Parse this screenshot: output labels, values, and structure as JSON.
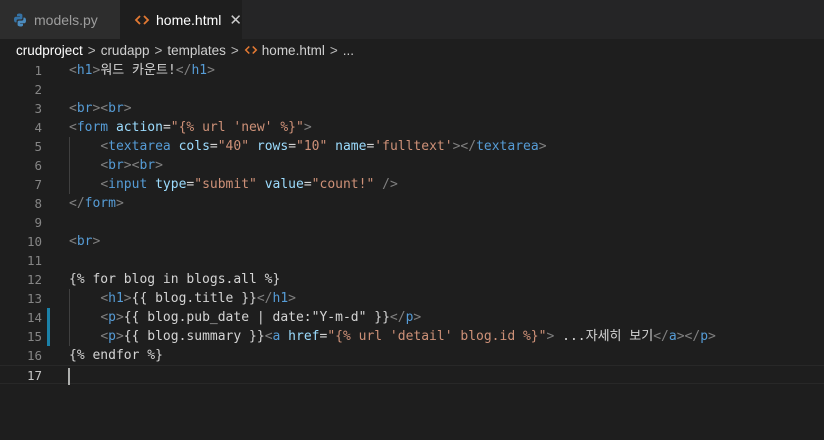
{
  "tabs": [
    {
      "label": "models.py",
      "icon": "python-icon",
      "active": false
    },
    {
      "label": "home.html",
      "icon": "html-icon",
      "active": true,
      "close": "✕"
    }
  ],
  "breadcrumb": {
    "items": [
      "crudproject",
      "crudapp",
      "templates",
      "home.html",
      "..."
    ],
    "separator": ">"
  },
  "colors": {
    "editor_bg": "#1e1e1e",
    "tag": "#569cd6",
    "attribute": "#9cdcfe",
    "string": "#ce9178",
    "text": "#d4d4d4",
    "bracket": "#808080",
    "line_number": "#858585",
    "modified_marker": "#1b81a8"
  },
  "editor": {
    "lines": [
      {
        "n": "1",
        "tokens": [
          [
            "br",
            "<"
          ],
          [
            "tag",
            "h1"
          ],
          [
            "br",
            ">"
          ],
          [
            "txt",
            "워드 카운트!"
          ],
          [
            "br",
            "</"
          ],
          [
            "tag",
            "h1"
          ],
          [
            "br",
            ">"
          ]
        ]
      },
      {
        "n": "2",
        "tokens": []
      },
      {
        "n": "3",
        "tokens": [
          [
            "br",
            "<"
          ],
          [
            "tag",
            "br"
          ],
          [
            "br",
            "><"
          ],
          [
            "tag",
            "br"
          ],
          [
            "br",
            ">"
          ]
        ]
      },
      {
        "n": "4",
        "tokens": [
          [
            "br",
            "<"
          ],
          [
            "tag",
            "form"
          ],
          [
            "txt",
            " "
          ],
          [
            "attr",
            "action"
          ],
          [
            "txt",
            "="
          ],
          [
            "str",
            "\"{% url 'new' %}\""
          ],
          [
            "br",
            ">"
          ]
        ]
      },
      {
        "n": "5",
        "tokens": [
          [
            "txt",
            "    "
          ],
          [
            "br",
            "<"
          ],
          [
            "tag",
            "textarea"
          ],
          [
            "txt",
            " "
          ],
          [
            "attr",
            "cols"
          ],
          [
            "txt",
            "="
          ],
          [
            "str",
            "\"40\""
          ],
          [
            "txt",
            " "
          ],
          [
            "attr",
            "rows"
          ],
          [
            "txt",
            "="
          ],
          [
            "str",
            "\"10\""
          ],
          [
            "txt",
            " "
          ],
          [
            "attr",
            "name"
          ],
          [
            "txt",
            "="
          ],
          [
            "str",
            "'fulltext'"
          ],
          [
            "br",
            "></"
          ],
          [
            "tag",
            "textarea"
          ],
          [
            "br",
            ">"
          ]
        ]
      },
      {
        "n": "6",
        "tokens": [
          [
            "txt",
            "    "
          ],
          [
            "br",
            "<"
          ],
          [
            "tag",
            "br"
          ],
          [
            "br",
            "><"
          ],
          [
            "tag",
            "br"
          ],
          [
            "br",
            ">"
          ]
        ]
      },
      {
        "n": "7",
        "tokens": [
          [
            "txt",
            "    "
          ],
          [
            "br",
            "<"
          ],
          [
            "tag",
            "input"
          ],
          [
            "txt",
            " "
          ],
          [
            "attr",
            "type"
          ],
          [
            "txt",
            "="
          ],
          [
            "str",
            "\"submit\""
          ],
          [
            "txt",
            " "
          ],
          [
            "attr",
            "value"
          ],
          [
            "txt",
            "="
          ],
          [
            "str",
            "\"count!\""
          ],
          [
            "txt",
            " "
          ],
          [
            "br",
            "/>"
          ]
        ]
      },
      {
        "n": "8",
        "tokens": [
          [
            "br",
            "</"
          ],
          [
            "tag",
            "form"
          ],
          [
            "br",
            ">"
          ]
        ]
      },
      {
        "n": "9",
        "tokens": []
      },
      {
        "n": "10",
        "tokens": [
          [
            "br",
            "<"
          ],
          [
            "tag",
            "br"
          ],
          [
            "br",
            ">"
          ]
        ]
      },
      {
        "n": "11",
        "tokens": []
      },
      {
        "n": "12",
        "tokens": [
          [
            "txt",
            "{% for blog in blogs.all %}"
          ]
        ]
      },
      {
        "n": "13",
        "tokens": [
          [
            "txt",
            "    "
          ],
          [
            "br",
            "<"
          ],
          [
            "tag",
            "h1"
          ],
          [
            "br",
            ">"
          ],
          [
            "txt",
            "{{ blog.title }}"
          ],
          [
            "br",
            "</"
          ],
          [
            "tag",
            "h1"
          ],
          [
            "br",
            ">"
          ]
        ]
      },
      {
        "n": "14",
        "tokens": [
          [
            "txt",
            "    "
          ],
          [
            "br",
            "<"
          ],
          [
            "tag",
            "p"
          ],
          [
            "br",
            ">"
          ],
          [
            "txt",
            "{{ blog.pub_date | date:\"Y-m-d\" }}"
          ],
          [
            "br",
            "</"
          ],
          [
            "tag",
            "p"
          ],
          [
            "br",
            ">"
          ]
        ]
      },
      {
        "n": "15",
        "tokens": [
          [
            "txt",
            "    "
          ],
          [
            "br",
            "<"
          ],
          [
            "tag",
            "p"
          ],
          [
            "br",
            ">"
          ],
          [
            "txt",
            "{{ blog.summary }}"
          ],
          [
            "br",
            "<"
          ],
          [
            "tag",
            "a"
          ],
          [
            "txt",
            " "
          ],
          [
            "attr",
            "href"
          ],
          [
            "txt",
            "="
          ],
          [
            "str",
            "\"{% url 'detail' blog.id %}\""
          ],
          [
            "br",
            ">"
          ],
          [
            "txt",
            " ...자세히 보기"
          ],
          [
            "br",
            "</"
          ],
          [
            "tag",
            "a"
          ],
          [
            "br",
            "></"
          ],
          [
            "tag",
            "p"
          ],
          [
            "br",
            ">"
          ]
        ]
      },
      {
        "n": "16",
        "tokens": [
          [
            "txt",
            "{% endfor %}"
          ]
        ]
      },
      {
        "n": "17",
        "tokens": []
      }
    ]
  }
}
